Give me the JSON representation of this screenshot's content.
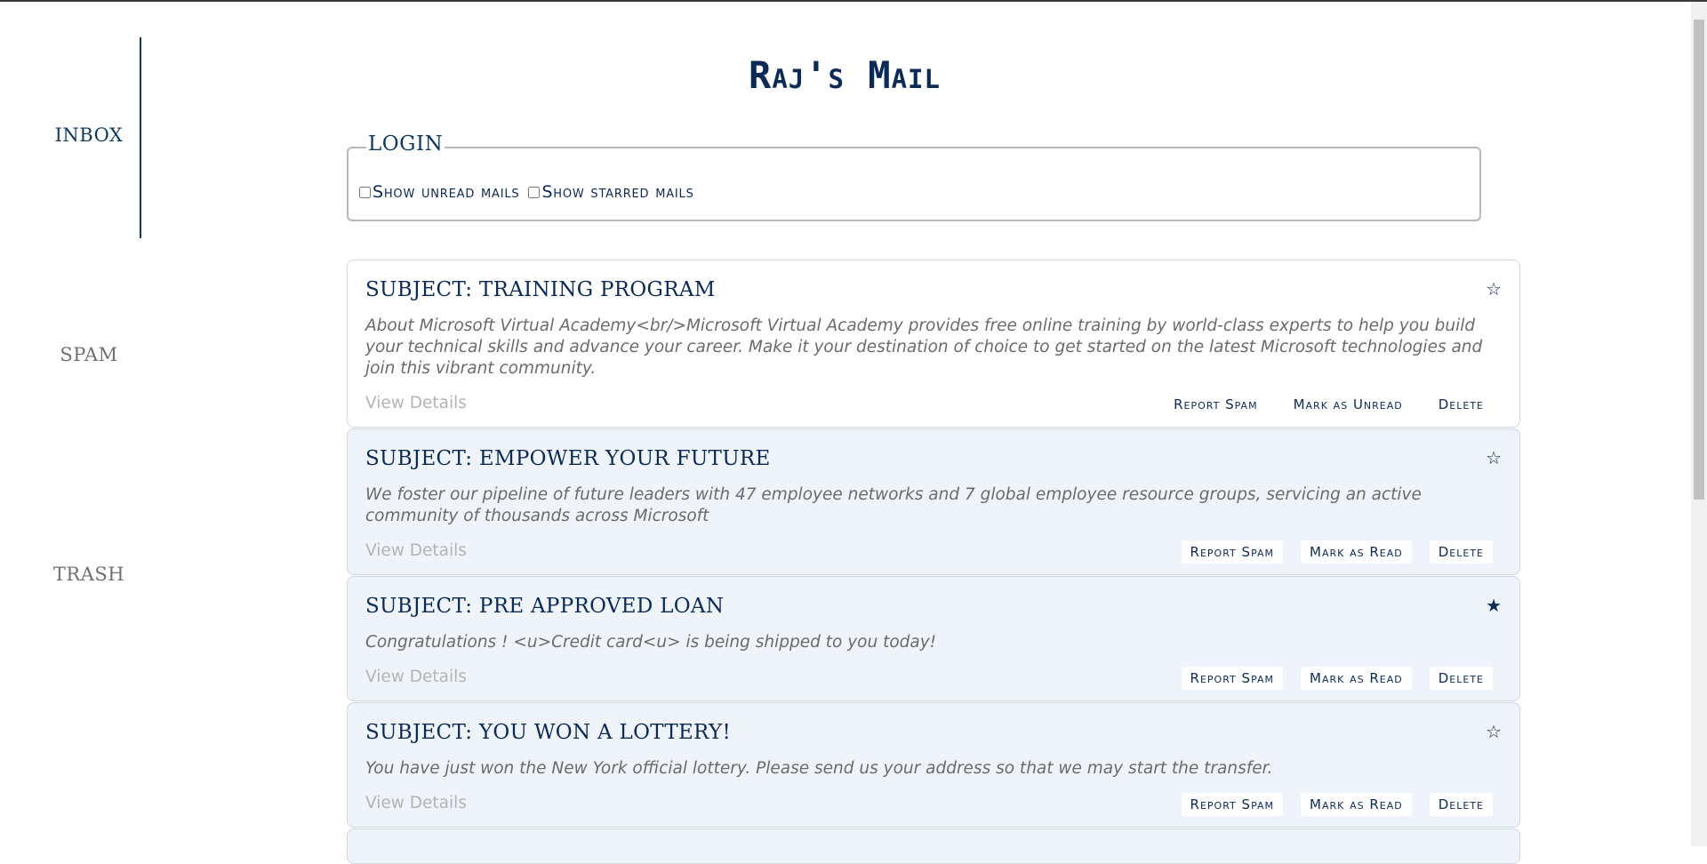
{
  "app": {
    "title": "Raj's Mail"
  },
  "sidebar": {
    "items": [
      {
        "label": "INBOX",
        "active": true
      },
      {
        "label": "SPAM"
      },
      {
        "label": "TRASH"
      }
    ]
  },
  "filters": {
    "legend": "LOGIN",
    "show_unread": {
      "label": "Show unread mails",
      "checked": false
    },
    "show_starred": {
      "label": "Show starred mails",
      "checked": false
    }
  },
  "mails": [
    {
      "subject": "SUBJECT: TRAINING PROGRAM",
      "starred": false,
      "star_glyph": "☆",
      "body": "About Microsoft Virtual Academy<br/>Microsoft Virtual Academy provides free online training by world-class experts to help you build your technical skills and advance your career. Make it your destination of choice to get started on the latest Microsoft technologies and join this vibrant community.",
      "view_details": "View Details",
      "spam_label": "Report Spam",
      "read_label": "Mark as Unread",
      "delete_label": "Delete"
    },
    {
      "subject": "SUBJECT: EMPOWER YOUR FUTURE",
      "starred": false,
      "star_glyph": "☆",
      "body": "We foster our pipeline of future leaders with 47 employee networks and 7 global employee resource groups, servicing an active community of thousands across Microsoft",
      "view_details": "View Details",
      "spam_label": "Report Spam",
      "read_label": "Mark as Read",
      "delete_label": "Delete"
    },
    {
      "subject": "SUBJECT: PRE APPROVED LOAN",
      "starred": true,
      "star_glyph": "★",
      "body": "Congratulations ! <u>Credit card<u> is being shipped to you today!",
      "view_details": "View Details",
      "spam_label": "Report Spam",
      "read_label": "Mark as Read",
      "delete_label": "Delete"
    },
    {
      "subject": "SUBJECT: YOU WON A LOTTERY!",
      "starred": false,
      "star_glyph": "☆",
      "body": "You have just won the New York official lottery. Please send us your address so that we may start the transfer.",
      "view_details": "View Details",
      "spam_label": "Report Spam",
      "read_label": "Mark as Read",
      "delete_label": "Delete"
    }
  ],
  "colors": {
    "accent": "#0b2a55",
    "card_unread_bg": "#eff3fa",
    "muted": "#b4b4b4"
  }
}
